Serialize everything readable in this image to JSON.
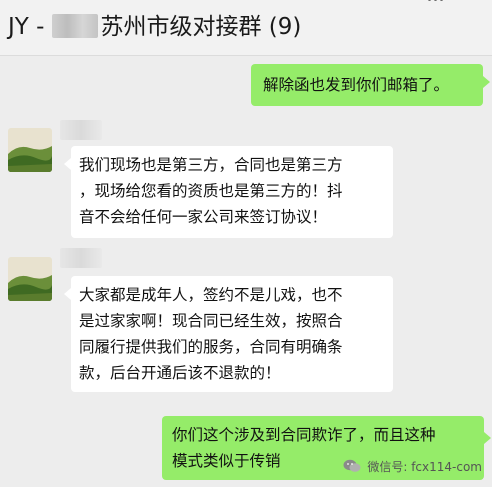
{
  "header": {
    "title_prefix": "JY -",
    "title_group": "苏州市级对接群 (9)"
  },
  "messages": [
    {
      "direction": "out",
      "text": "解除函也发到你们邮箱了。"
    },
    {
      "direction": "in",
      "text": "我们现场也是第三方，合同也是第三方\n，现场给您看的资质也是第三方的！抖\n音不会给任何一家公司来签订协议！"
    },
    {
      "direction": "in",
      "text": "大家都是成年人，签约不是儿戏，也不\n是过家家啊！现合同已经生效，按照合\n同履行提供我们的服务，合同有明确条\n款，后台开通后该不退款的！"
    },
    {
      "direction": "out",
      "text": "你们这个涉及到合同欺诈了，而且这种\n模式类似于传销"
    }
  ],
  "watermark": {
    "text": "微信号: fcx114-com"
  },
  "colors": {
    "outgoing_bubble": "#95ec69",
    "incoming_bubble": "#ffffff",
    "background": "#ededed"
  },
  "icons": {
    "avatar": "landscape-avatar-icon",
    "watermark": "wechat-logo-icon",
    "more": "more-dots-icon"
  }
}
